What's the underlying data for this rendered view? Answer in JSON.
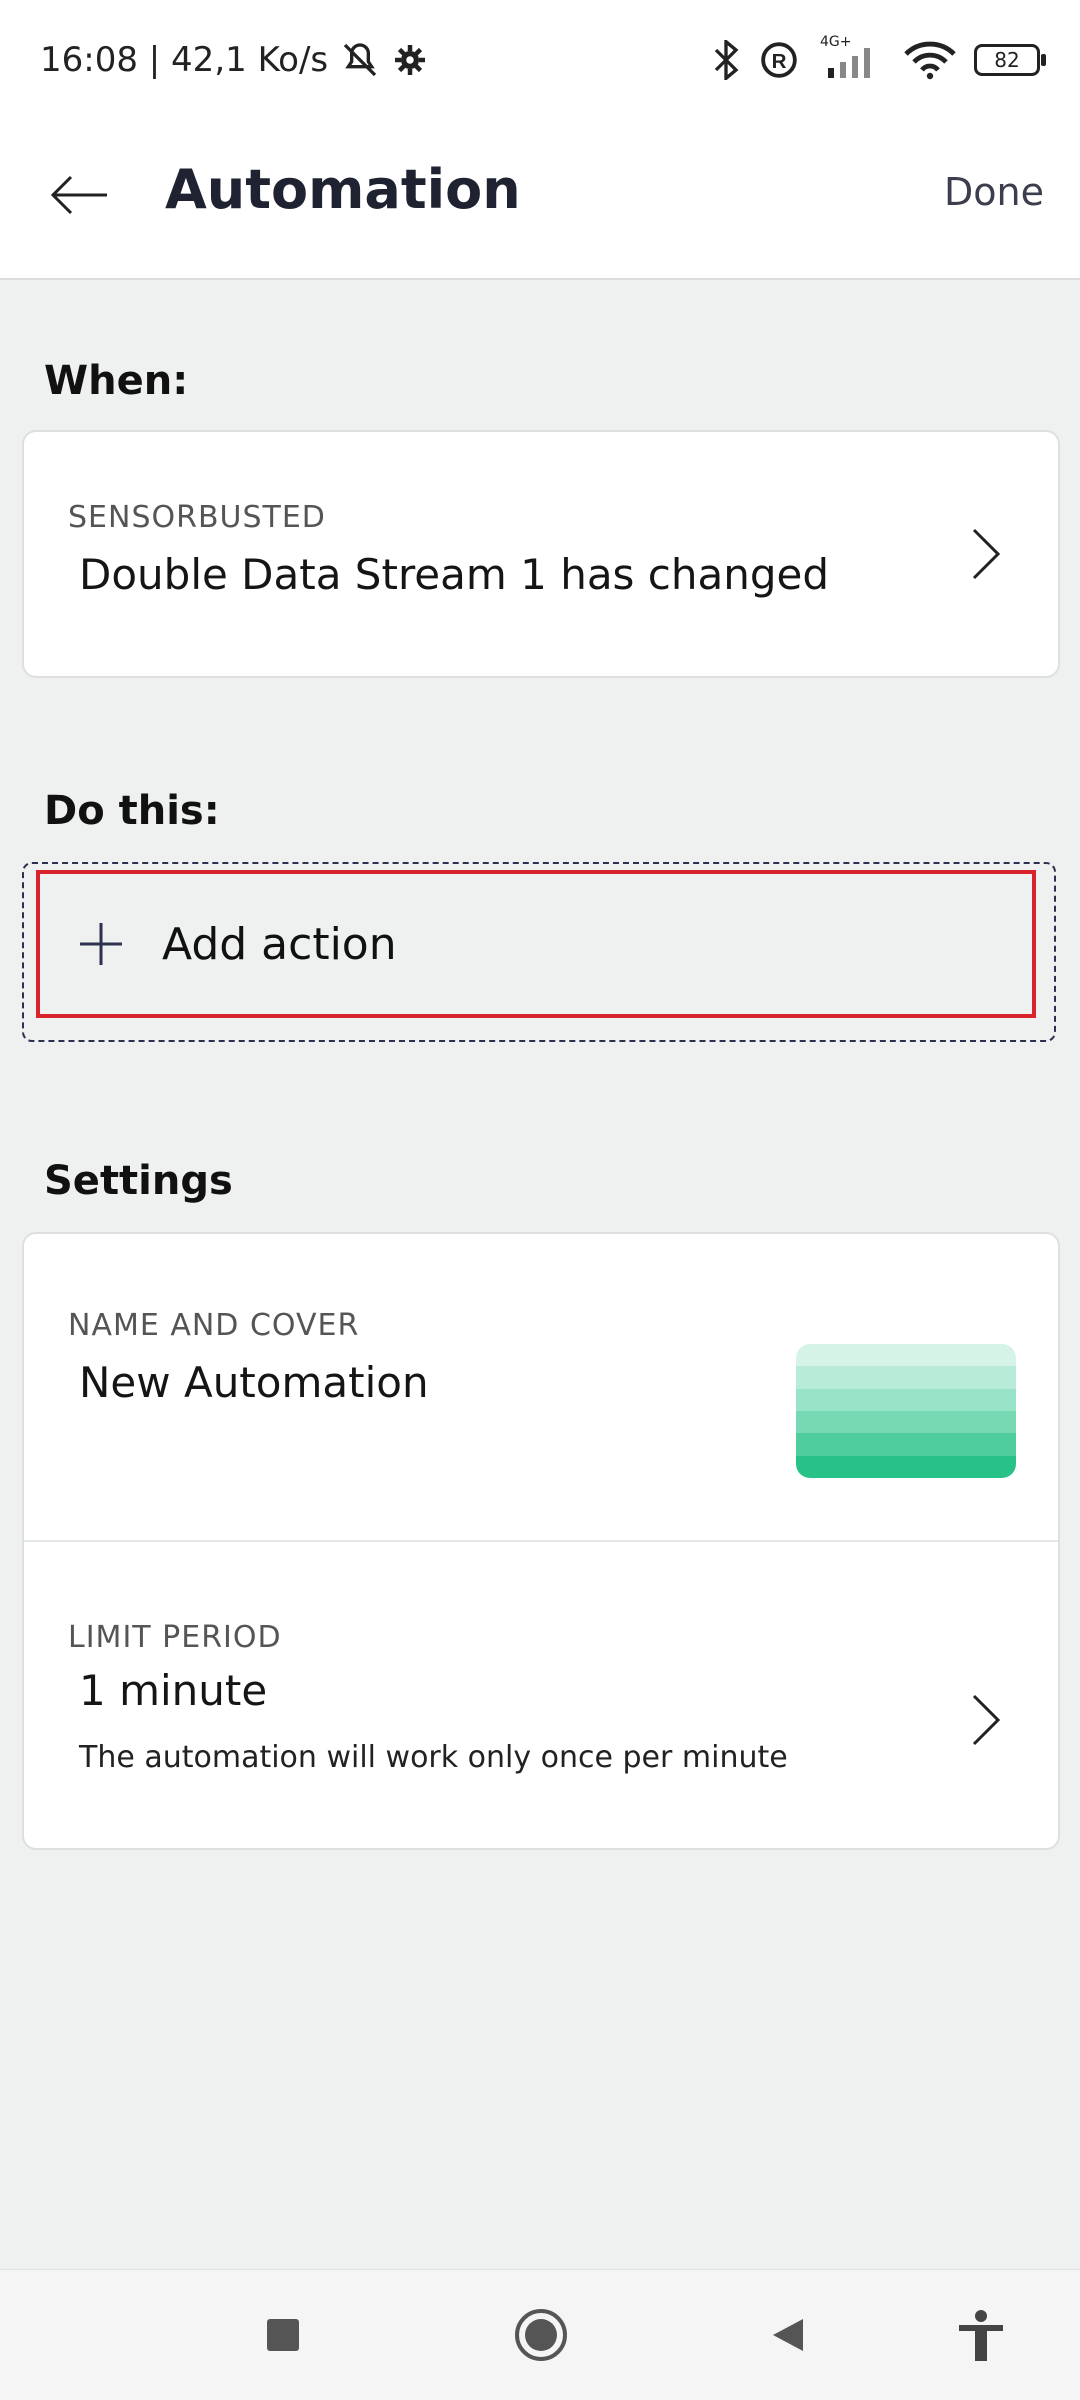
{
  "status_bar": {
    "time_text": "16:08 | 42,1 Ko/s",
    "network_type": "4G+",
    "battery_level": "82"
  },
  "header": {
    "title": "Automation",
    "done_label": "Done"
  },
  "when": {
    "section_label": "When:",
    "overline": "SENSORBUSTED",
    "value": "Double Data Stream 1 has changed"
  },
  "do_this": {
    "section_label": "Do this:",
    "add_action_label": "Add action"
  },
  "settings": {
    "section_label": "Settings",
    "name_cover": {
      "overline": "NAME AND COVER",
      "value": "New Automation",
      "cover_colors": [
        "#d6f3e8",
        "#b8ecd9",
        "#99e3c8",
        "#76d9b4",
        "#4fcd9d",
        "#27c288"
      ]
    },
    "limit_period": {
      "overline": "LIMIT PERIOD",
      "value": "1 minute",
      "description": "The automation will work only once per minute"
    }
  },
  "colors": {
    "background": "#eef1f0",
    "highlight_border": "#d8232c",
    "accent": "#27c288"
  }
}
